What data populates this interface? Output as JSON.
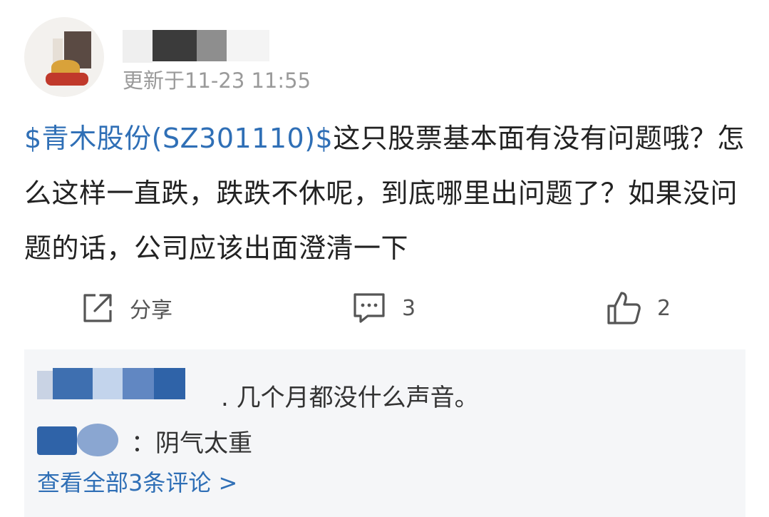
{
  "post": {
    "updated_time": "更新于11-23 11:55",
    "stock_tag": "$青木股份(SZ301110)$",
    "content": "这只股票基本面有没有问题哦？怎么这样一直跌，跌跌不休呢，到底哪里出问题了？如果没问题的话，公司应该出面澄清一下"
  },
  "actions": {
    "share_label": "分享",
    "comment_count": "3",
    "like_count": "2",
    "icons": [
      "share-icon",
      "comment-icon",
      "like-icon"
    ]
  },
  "comments": {
    "items": [
      {
        "text": ". 几个月都没什么声音。"
      },
      {
        "text": "：阴气太重"
      }
    ],
    "view_all_label": "查看全部3条评论 >"
  },
  "colors": {
    "link_blue": "#2f6fb6",
    "comment_bg": "#f5f6f8",
    "muted_text": "#9a9a9a"
  }
}
